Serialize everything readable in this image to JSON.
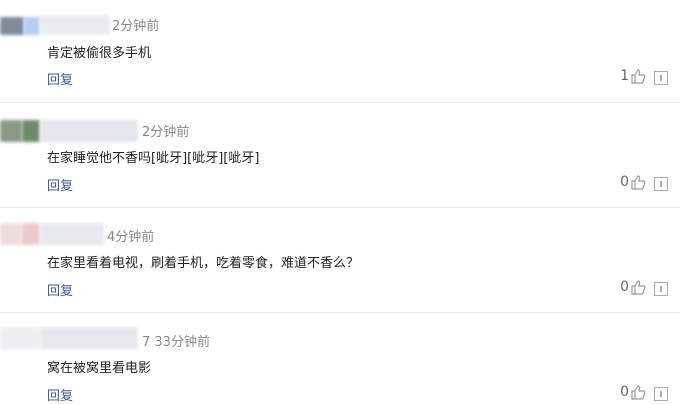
{
  "comments": [
    {
      "time": "2分钟前",
      "text": "肯定被偷很多手机",
      "reply_label": "回复",
      "likes": "1"
    },
    {
      "time": "2分钟前",
      "text": "在家睡觉他不香吗[呲牙][呲牙][呲牙]",
      "reply_label": "回复",
      "likes": "0"
    },
    {
      "time": "4分钟前",
      "text": "在家里看着电视，刷着手机，吃着零食，难道不香么？",
      "reply_label": "回复",
      "likes": "0"
    },
    {
      "time": "7 33分钟前",
      "text": "窝在被窝里看电影",
      "reply_label": "回复",
      "likes": "0"
    }
  ],
  "icons": {
    "like": "thumbs-up-icon",
    "report": "report-icon"
  },
  "colors": {
    "reply_link": "#3b5998",
    "divider": "#e8e8e8",
    "meta_text": "#888888"
  }
}
